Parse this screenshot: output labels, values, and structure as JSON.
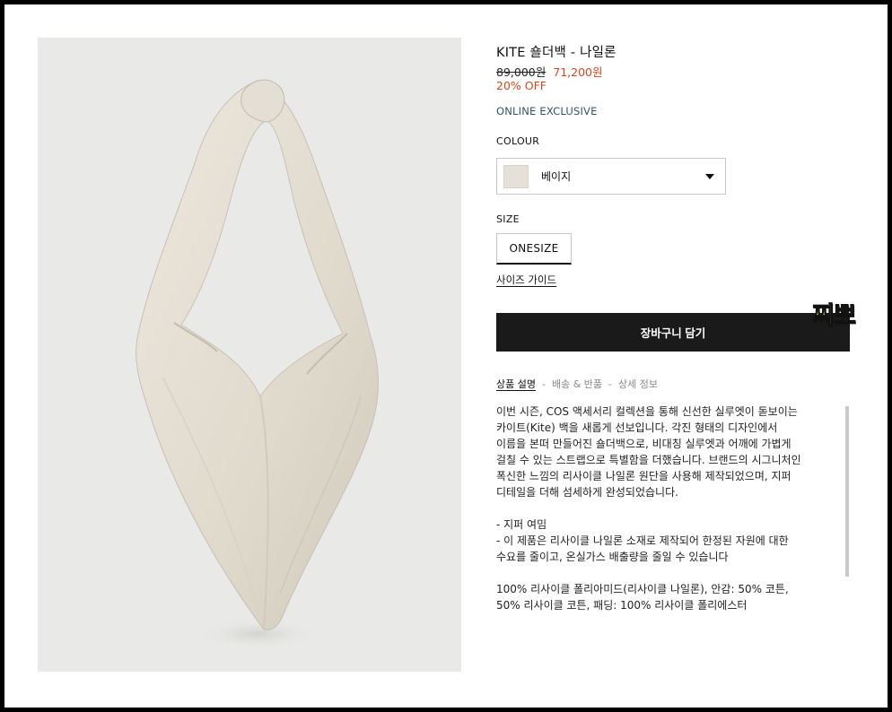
{
  "product": {
    "title": "KITE 숄더백 - 나일론",
    "price_original": "89,000원",
    "price_sale": "71,200원",
    "discount": "20% OFF",
    "exclusive": "ONLINE EXCLUSIVE",
    "image_icon": "bag-photo"
  },
  "colour": {
    "label": "COLOUR",
    "selected": "베이지",
    "swatch_color": "#e6e1d8"
  },
  "size": {
    "label": "SIZE",
    "selected": "ONESIZE",
    "guide_link": "사이즈 가이드"
  },
  "cart": {
    "add_label": "장바구니 담기"
  },
  "sticker": {
    "text": "찌뽀"
  },
  "tabs": [
    {
      "label": "상품 설명"
    },
    {
      "label": "배송 & 반품"
    },
    {
      "label": "상세 정보"
    }
  ],
  "tab_separator": "-",
  "description": {
    "paragraph1": [
      "이번 시즌, COS 액세서리 컬렉션을 통해 신선한 실루엣이 돋보이는",
      "카이트(Kite) 백을 새롭게 선보입니다. 각진 형태의 디자인에서",
      "이름을 본떠 만들어진 숄더백으로, 비대칭 실루엣과 어깨에 가볍게",
      "걸칠 수 있는 스트랩으로 특별함을 더했습니다. 브랜드의 시그니처인",
      "폭신한 느낌의 리사이클 나일론 원단을 사용해 제작되었으며, 지퍼",
      "디테일을 더해 섬세하게 완성되었습니다."
    ],
    "bullets": [
      "- 지퍼 여밈",
      "- 이 제품은 리사이클 나일론 소재로 제작되어 한정된 자원에 대한",
      "수요를 줄이고, 온실가스 배출량을 줄일 수 있습니다"
    ],
    "materials": [
      "100% 리사이클 폴리아미드(리사이클 나일론), 안감: 50% 코튼,",
      "50% 리사이클 코튼, 패딩: 100% 리사이클 폴리에스터"
    ]
  }
}
